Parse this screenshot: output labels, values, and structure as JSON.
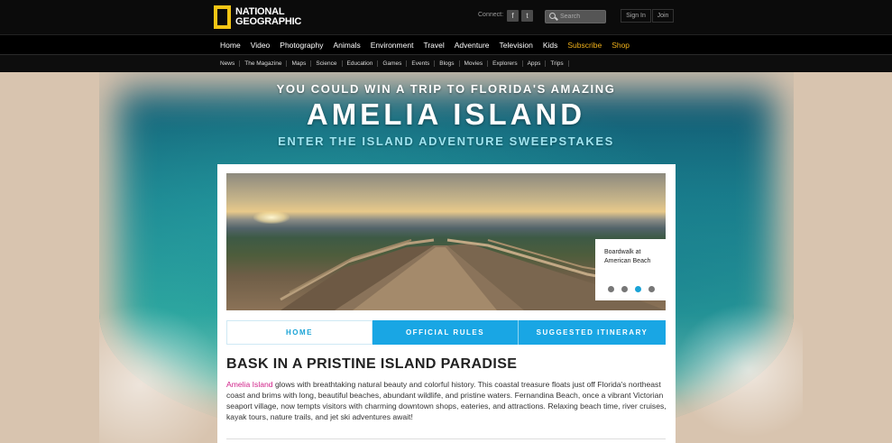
{
  "header": {
    "logo_line1": "NATIONAL",
    "logo_line2": "GEOGRAPHIC",
    "connect_label": "Connect:",
    "facebook_glyph": "f",
    "twitter_glyph": "t",
    "search_placeholder": "Search",
    "signin_label": "Sign In",
    "join_label": "Join"
  },
  "main_nav": [
    {
      "label": "Home"
    },
    {
      "label": "Video"
    },
    {
      "label": "Photography"
    },
    {
      "label": "Animals"
    },
    {
      "label": "Environment"
    },
    {
      "label": "Travel"
    },
    {
      "label": "Adventure"
    },
    {
      "label": "Television"
    },
    {
      "label": "Kids"
    },
    {
      "label": "Subscribe"
    },
    {
      "label": "Shop"
    }
  ],
  "sub_nav": [
    {
      "label": "News"
    },
    {
      "label": "The Magazine"
    },
    {
      "label": "Maps"
    },
    {
      "label": "Science"
    },
    {
      "label": "Education"
    },
    {
      "label": "Games"
    },
    {
      "label": "Events"
    },
    {
      "label": "Blogs"
    },
    {
      "label": "Movies"
    },
    {
      "label": "Explorers"
    },
    {
      "label": "Apps"
    },
    {
      "label": "Trips"
    }
  ],
  "hero": {
    "line1": "YOU COULD WIN A TRIP TO FLORIDA'S AMAZING",
    "line2": "AMELIA ISLAND",
    "line3": "ENTER THE ISLAND ADVENTURE SWEEPSTAKES"
  },
  "slideshow": {
    "caption": "Boardwalk at American Beach",
    "active_dot": 3,
    "dot_count": 4
  },
  "tabs": {
    "home": "HOME",
    "rules": "OFFICIAL RULES",
    "itinerary": "SUGGESTED ITINERARY"
  },
  "article": {
    "headline": "BASK IN A PRISTINE ISLAND PARADISE",
    "link_text": "Amelia Island",
    "body": " glows with breathtaking natural beauty and colorful history. This coastal treasure floats just off Florida's northeast coast and brims with long, beautiful beaches, abundant wildlife, and pristine waters. Fernandina Beach, once a vibrant Victorian seaport village, now tempts visitors with charming downtown shops, eateries, and attractions. Relaxing beach time, river cruises, kayak tours, nature trails, and jet ski adventures await!"
  },
  "colors": {
    "accent_blue": "#19a6e4",
    "link_pink": "#d1238a",
    "nav_highlight": "#f2b21a",
    "logo_yellow": "#f3c515"
  }
}
